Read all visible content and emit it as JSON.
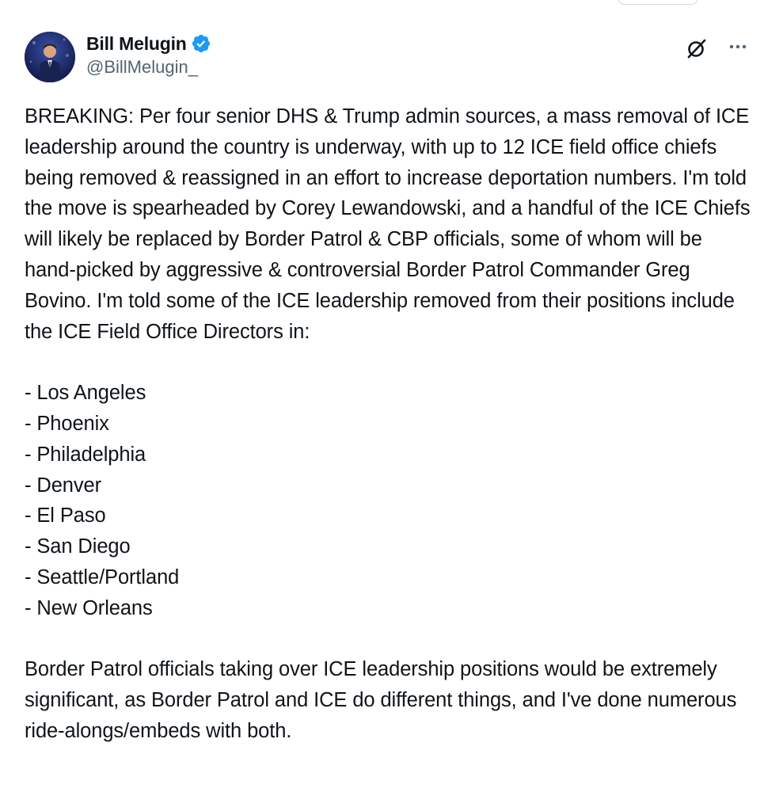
{
  "author": {
    "display_name": "Bill Melugin",
    "handle": "@BillMelugin_",
    "verified": true,
    "verified_color": "#1d9bf0"
  },
  "actions": {
    "grok_icon": "grok-icon",
    "more_icon": "more-horizontal-icon"
  },
  "tweet": {
    "intro": "BREAKING: Per four senior DHS & Trump admin sources, a mass removal of ICE leadership around the country is underway, with up to 12 ICE field office chiefs being removed & reassigned in an effort to increase deportation numbers. I'm told the move is spearheaded by Corey Lewandowski, and a handful of the ICE Chiefs will likely be replaced by Border Patrol & CBP officials, some of whom will be hand-picked by aggressive & controversial Border Patrol Commander Greg Bovino. I'm told some of the ICE leadership removed from their positions include the ICE Field Office Directors in:",
    "cities": [
      "- Los Angeles",
      "- Phoenix",
      "- Philadelphia",
      "- Denver",
      "- El Paso",
      "- San Diego",
      "- Seattle/Portland",
      "- New Orleans"
    ],
    "closing": "Border Patrol officials taking over ICE leadership positions would be extremely significant, as Border Patrol and ICE do different things, and I've done numerous ride-alongs/embeds with both."
  }
}
